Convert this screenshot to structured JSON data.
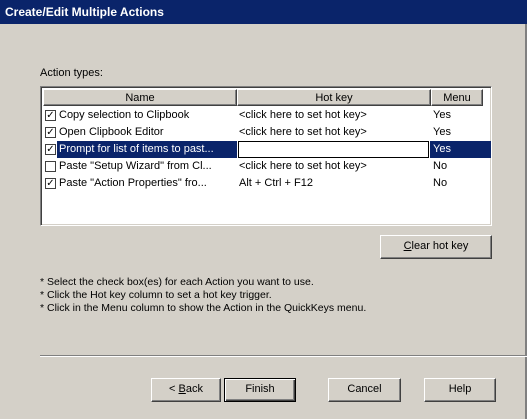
{
  "window": {
    "title": "Create/Edit Multiple Actions"
  },
  "labels": {
    "action_types": "Action types:"
  },
  "list": {
    "columns": {
      "name": "Name",
      "hotkey": "Hot key",
      "menu": "Menu"
    },
    "rows": [
      {
        "checked": true,
        "name": "Copy selection to Clipbook",
        "hotkey": "<click here to set hot key>",
        "menu": "Yes",
        "selected": false
      },
      {
        "checked": true,
        "name": "Open Clipbook Editor",
        "hotkey": "<click here to set hot key>",
        "menu": "Yes",
        "selected": false
      },
      {
        "checked": true,
        "name": "Prompt for list of items to past...",
        "hotkey": "",
        "menu": "Yes",
        "selected": true
      },
      {
        "checked": false,
        "name": "Paste \"Setup Wizard\" from Cl...",
        "hotkey": "<click here to set hot key>",
        "menu": "No",
        "selected": false
      },
      {
        "checked": true,
        "name": "Paste \"Action Properties\" fro...",
        "hotkey": "Alt + Ctrl + F12",
        "menu": "No",
        "selected": false
      }
    ]
  },
  "buttons": {
    "clear_hotkey_mnemonic": "C",
    "clear_hotkey_rest": "lear hot key",
    "back_prefix": "< ",
    "back_mnemonic": "B",
    "back_rest": "ack",
    "finish": "Finish",
    "cancel": "Cancel",
    "help": "Help"
  },
  "instructions": [
    "* Select the check box(es) for each Action you want to use.",
    "* Click the Hot key column to set a hot key trigger.",
    "* Click in the Menu column to show the Action in the QuickKeys menu."
  ],
  "colors": {
    "titlebar": "#0a246a",
    "selection": "#0a246a",
    "face": "#d4d0c8"
  },
  "icons": {
    "checked": "check-mark"
  }
}
